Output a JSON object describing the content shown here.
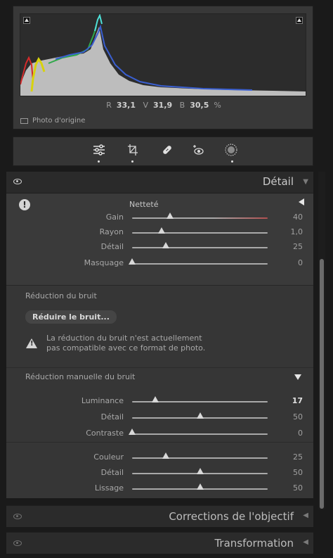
{
  "histogram": {
    "rvb": {
      "r_label": "R",
      "r_value": "33,1",
      "v_label": "V",
      "v_value": "31,9",
      "b_label": "B",
      "b_value": "30,5",
      "unit": "%"
    },
    "original_photo_label": "Photo d'origine"
  },
  "tools": [
    "adjust-icon",
    "crop-icon",
    "healing-icon",
    "redeye-icon",
    "masking-icon"
  ],
  "detail": {
    "title": "Détail",
    "sharpening": {
      "title": "Netteté",
      "sliders": [
        {
          "label": "Gain",
          "value": "40",
          "pos": 0.28
        },
        {
          "label": "Rayon",
          "value": "1,0",
          "pos": 0.22
        },
        {
          "label": "Détail",
          "value": "25",
          "pos": 0.25
        },
        {
          "label": "Masquage",
          "value": "0",
          "pos": 0.0
        }
      ]
    },
    "noise": {
      "title": "Réduction du bruit",
      "button": "Réduire le bruit...",
      "warning_line1": "La réduction du bruit n'est actuellement",
      "warning_line2": "pas compatible avec ce format de photo.",
      "manual_title": "Réduction manuelle du bruit",
      "luminance_sliders": [
        {
          "label": "Luminance",
          "value": "17",
          "pos": 0.17
        },
        {
          "label": "Détail",
          "value": "50",
          "pos": 0.5
        },
        {
          "label": "Contraste",
          "value": "0",
          "pos": 0.0
        }
      ],
      "color_sliders": [
        {
          "label": "Couleur",
          "value": "25",
          "pos": 0.25
        },
        {
          "label": "Détail",
          "value": "50",
          "pos": 0.5
        },
        {
          "label": "Lissage",
          "value": "50",
          "pos": 0.5
        }
      ]
    }
  },
  "collapsed_panels": [
    "Corrections de l'objectif",
    "Transformation"
  ],
  "colors": {
    "accent": "#d8d8d8",
    "panel": "#3a3a3a",
    "background": "#1a1a1a"
  }
}
